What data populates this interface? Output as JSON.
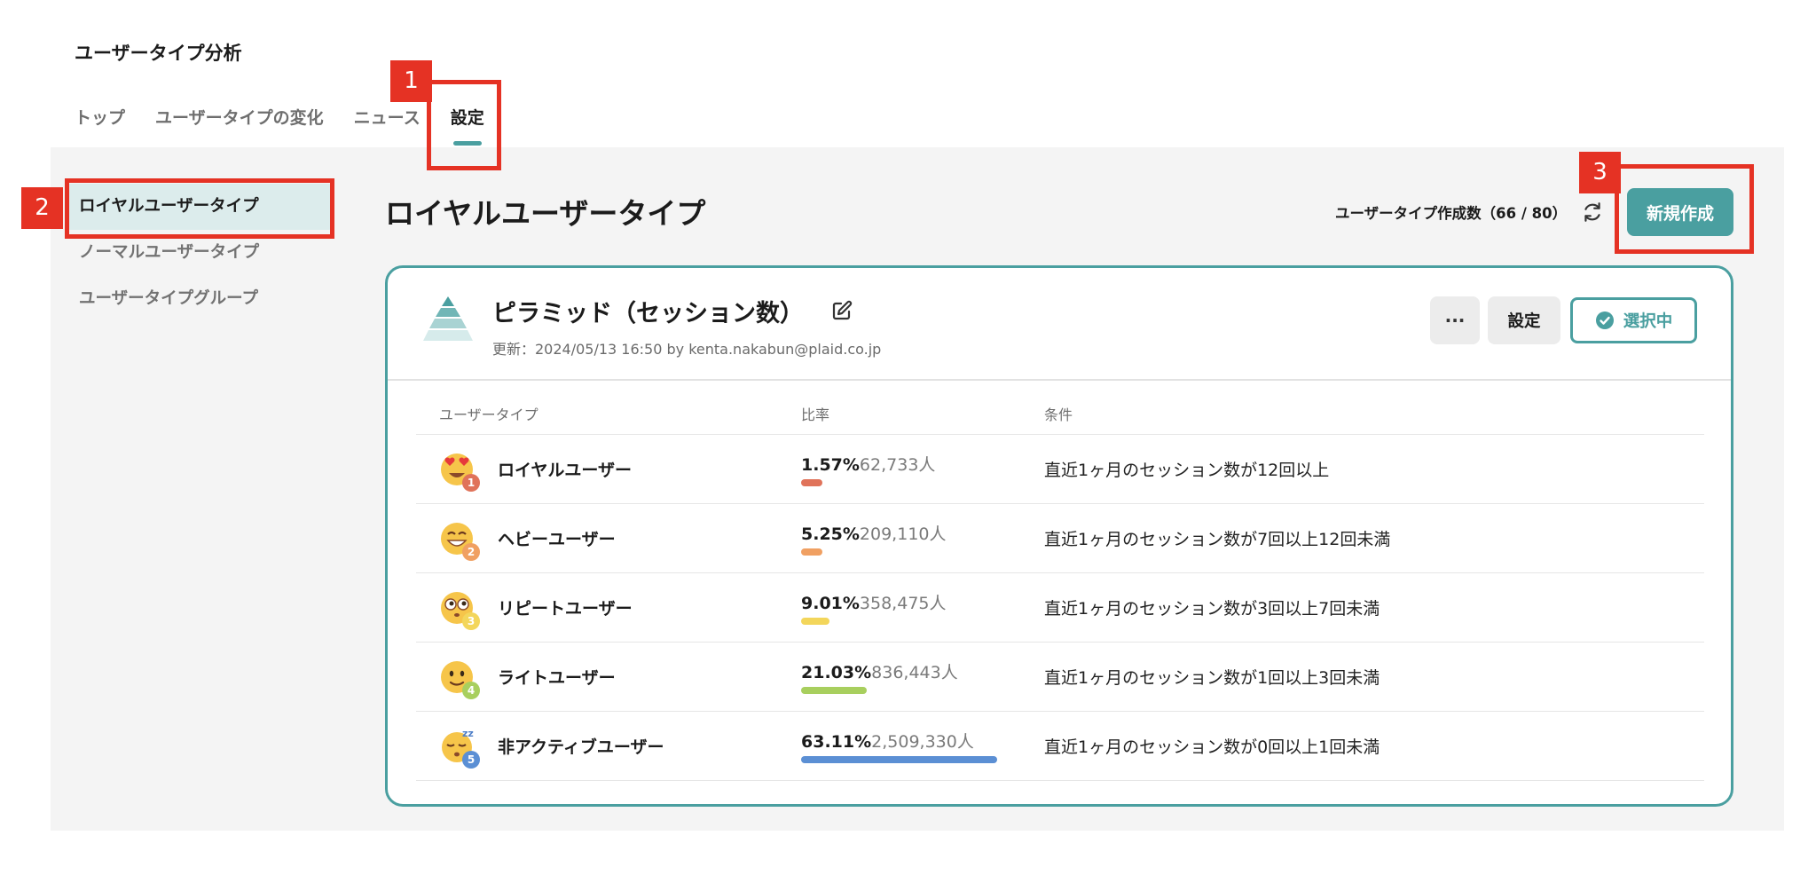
{
  "app": {
    "title": "ユーザータイプ分析"
  },
  "tabs": [
    {
      "label": "トップ"
    },
    {
      "label": "ユーザータイプの変化"
    },
    {
      "label": "ニュース"
    },
    {
      "label": "設定"
    }
  ],
  "active_tab": "設定",
  "sidebar": {
    "items": [
      {
        "label": "ロイヤルユーザータイプ"
      },
      {
        "label": "ノーマルユーザータイプ"
      },
      {
        "label": "ユーザータイプグループ"
      }
    ]
  },
  "header": {
    "title": "ロイヤルユーザータイプ",
    "count_label": "ユーザータイプ作成数（66 / 80）",
    "new_button_label": "新規作成"
  },
  "card": {
    "title": "ピラミッド（セッション数）",
    "updated": "更新：2024/05/13 16:50 by kenta.nakabun@plaid.co.jp",
    "more_label": "···",
    "settings_label": "設定",
    "selected_label": "選択中",
    "columns": {
      "type": "ユーザータイプ",
      "ratio": "比率",
      "condition": "条件"
    },
    "rows": [
      {
        "badge": "1",
        "name": "ロイヤルユーザー",
        "pct": "1.57%",
        "persons": "62,733人",
        "ratio": 0.0157,
        "bar_color": "#e0735a",
        "condition": "直近1ヶ月のセッション数が12回以上"
      },
      {
        "badge": "2",
        "name": "ヘビーユーザー",
        "pct": "5.25%",
        "persons": "209,110人",
        "ratio": 0.0525,
        "bar_color": "#f0a062",
        "condition": "直近1ヶ月のセッション数が7回以上12回未満"
      },
      {
        "badge": "3",
        "name": "リピートユーザー",
        "pct": "9.01%",
        "persons": "358,475人",
        "ratio": 0.0901,
        "bar_color": "#f3d65b",
        "condition": "直近1ヶ月のセッション数が3回以上7回未満"
      },
      {
        "badge": "4",
        "name": "ライトユーザー",
        "pct": "21.03%",
        "persons": "836,443人",
        "ratio": 0.2103,
        "bar_color": "#a8cf5e",
        "condition": "直近1ヶ月のセッション数が1回以上3回未満"
      },
      {
        "badge": "5",
        "name": "非アクティブユーザー",
        "pct": "63.11%",
        "persons": "2,509,330人",
        "ratio": 0.6311,
        "bar_color": "#5b8fd4",
        "condition": "直近1ヶ月のセッション数が0回以上1回未満"
      }
    ]
  },
  "annotations": [
    {
      "label": "1"
    },
    {
      "label": "2"
    },
    {
      "label": "3"
    }
  ]
}
